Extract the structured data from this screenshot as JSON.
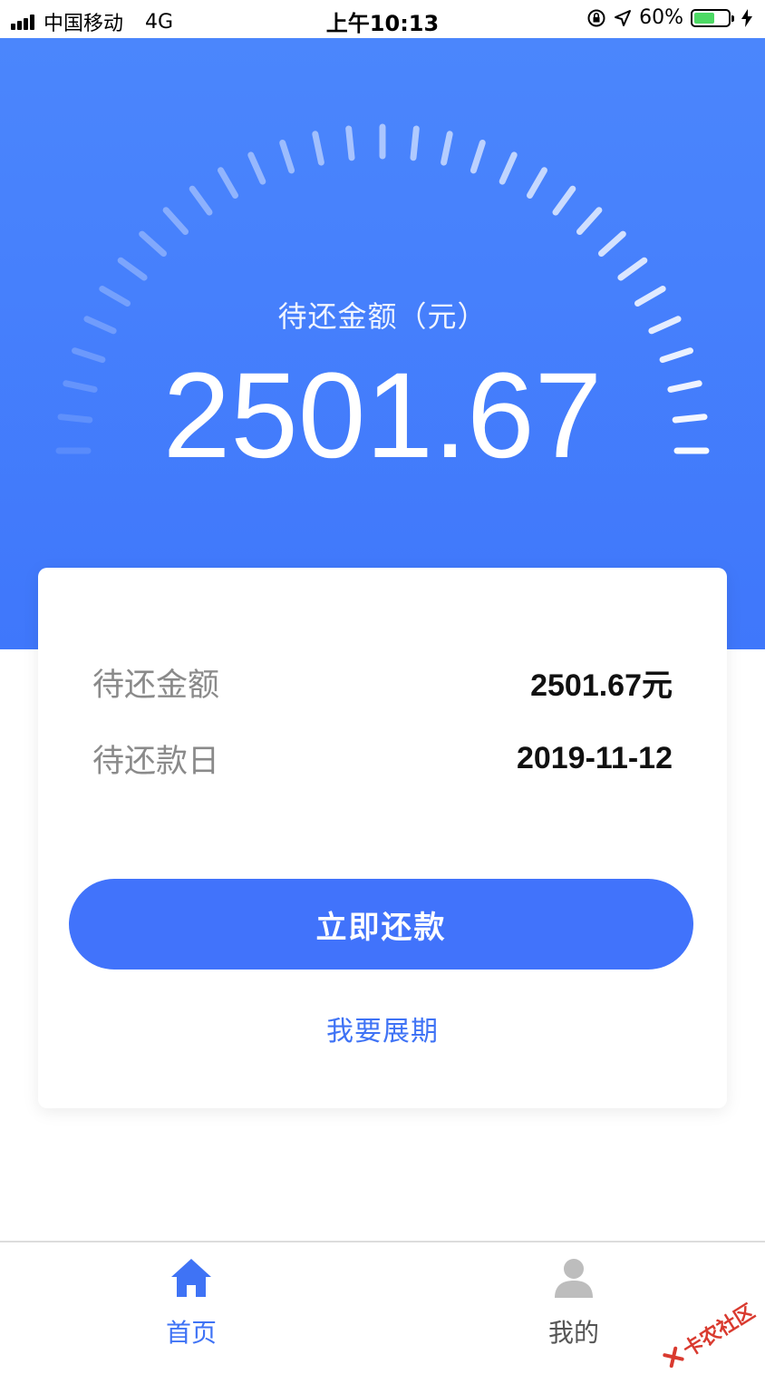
{
  "status_bar": {
    "carrier": "中国移动",
    "network": "4G",
    "time": "上午10:13",
    "battery": "60%"
  },
  "hero": {
    "label": "待还金额（元）",
    "amount": "2501.67"
  },
  "card": {
    "rows": [
      {
        "label": "待还金额",
        "value": "2501.67元"
      },
      {
        "label": "待还款日",
        "value": "2019-11-12"
      }
    ],
    "pay_button": "立即还款",
    "extend_link": "我要展期"
  },
  "tabbar": {
    "items": [
      {
        "label": "首页",
        "icon": "home-icon",
        "active": true
      },
      {
        "label": "我的",
        "icon": "person-icon",
        "active": false
      }
    ]
  },
  "watermark": "卡农社区",
  "colors": {
    "accent": "#4173fb",
    "hero_top": "#4b86fc",
    "hero_bottom": "#3f77fb",
    "battery_fill": "#4cd964"
  }
}
